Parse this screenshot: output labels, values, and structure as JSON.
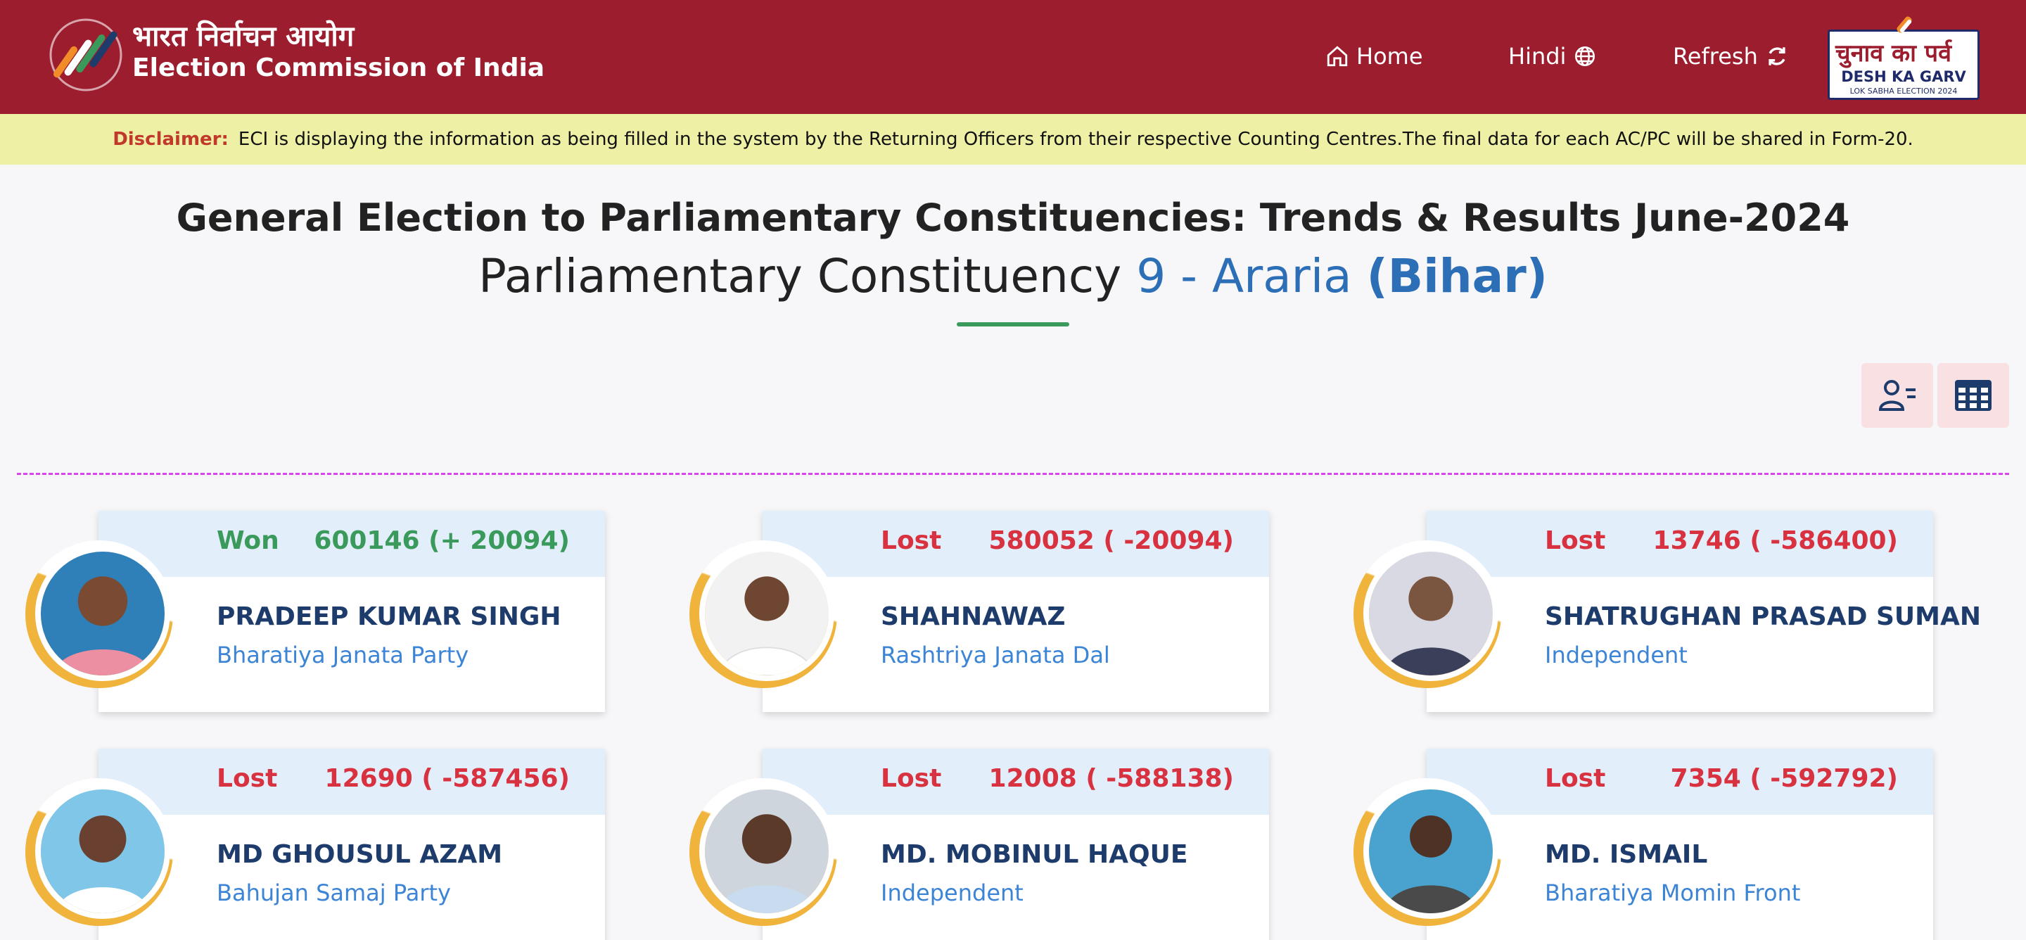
{
  "header": {
    "brand_hindi": "भारत निर्वाचन आयोग",
    "brand_english": "Election Commission of India",
    "nav": {
      "home": "Home",
      "hindi": "Hindi",
      "refresh": "Refresh"
    },
    "badge": {
      "hindi": "चुनाव का पर्व",
      "english": "DESH KA GARV",
      "sub": "LOK SABHA ELECTION 2024"
    },
    "bg_color": "#9b1d2e"
  },
  "disclaimer": {
    "label": "Disclaimer:",
    "text": "ECI is displaying the information as being filled in the system by the Returning Officers from their respective Counting Centres.The final data for each AC/PC will be shared in Form-20."
  },
  "page": {
    "title": "General Election to Parliamentary Constituencies: Trends & Results June-2024",
    "subtitle_prefix": "Parliamentary Constituency",
    "constituency": "9 - Araria",
    "state": "(Bihar)"
  },
  "view_toggle": {
    "card_icon": "user-list-icon",
    "table_icon": "table-grid-icon"
  },
  "candidates": [
    {
      "status": "Won",
      "votes": "600146 (+ 20094)",
      "name": "PRADEEP KUMAR SINGH",
      "party": "Bharatiya Janata Party"
    },
    {
      "status": "Lost",
      "votes": "580052 ( -20094)",
      "name": "SHAHNAWAZ",
      "party": "Rashtriya Janata Dal"
    },
    {
      "status": "Lost",
      "votes": "13746 ( -586400)",
      "name": "SHATRUGHAN PRASAD SUMAN",
      "party": "Independent"
    },
    {
      "status": "Lost",
      "votes": "12690 ( -587456)",
      "name": "MD GHOUSUL AZAM",
      "party": "Bahujan Samaj Party"
    },
    {
      "status": "Lost",
      "votes": "12008 ( -588138)",
      "name": "MD. MOBINUL HAQUE",
      "party": "Independent"
    },
    {
      "status": "Lost",
      "votes": "7354 ( -592792)",
      "name": "MD. ISMAIL",
      "party": "Bharatiya Momin Front"
    }
  ],
  "colors": {
    "won": "#3a9a5b",
    "lost": "#d8313f",
    "accent_blue": "#2c6fb7",
    "card_head": "#e3eefb"
  }
}
